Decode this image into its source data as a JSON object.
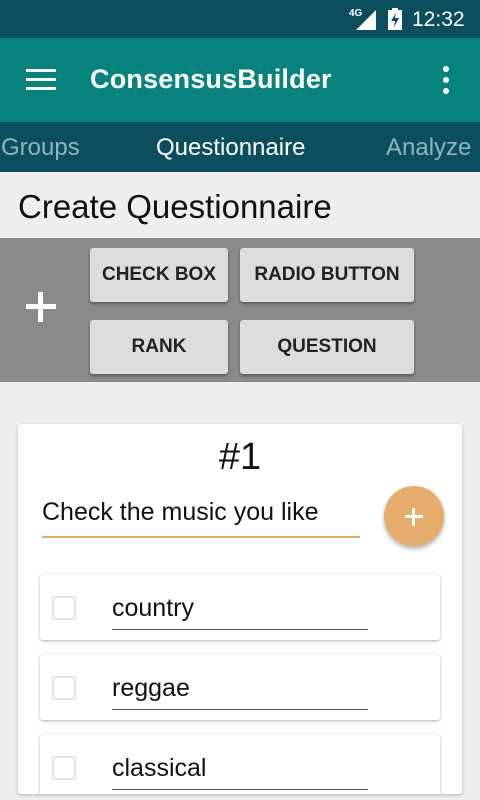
{
  "status_bar": {
    "network": "4G",
    "time": "12:32"
  },
  "app_bar": {
    "title": "ConsensusBuilder"
  },
  "tabs": [
    {
      "label": "Groups",
      "active": false
    },
    {
      "label": "Questionnaire",
      "active": true
    },
    {
      "label": "Analyze",
      "active": false
    }
  ],
  "page": {
    "title": "Create Questionnaire"
  },
  "toolbar": {
    "check_box_label": "CHECK BOX",
    "radio_button_label": "RADIO BUTTON",
    "rank_label": "RANK",
    "question_label": "QUESTION"
  },
  "question": {
    "number": "#1",
    "text": "Check the music you like",
    "options": [
      {
        "label": "country",
        "checked": false
      },
      {
        "label": "reggae",
        "checked": false
      },
      {
        "label": "classical",
        "checked": false
      }
    ]
  },
  "colors": {
    "status_bar": "#0b4f5e",
    "app_bar": "#07837d",
    "tab_bar": "#0b4f5e",
    "toolbar": "#8a8a8a",
    "accent": "#e5ac6b"
  }
}
